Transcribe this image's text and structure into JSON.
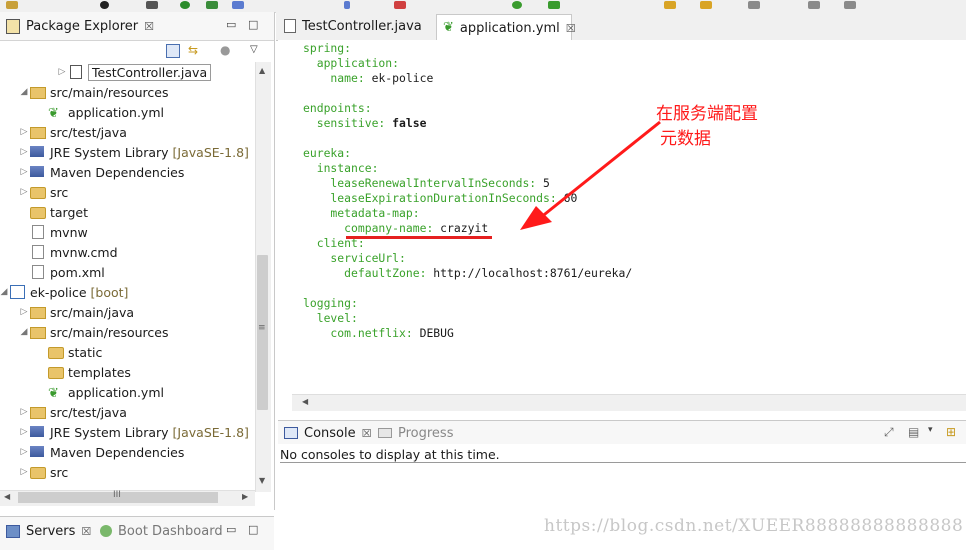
{
  "explorer": {
    "tab_label": "Package Explorer",
    "close": "☒",
    "rows": [
      {
        "label": "TestController.java",
        "deco": "",
        "type": "java"
      },
      {
        "label": "src/main/resources",
        "deco": "",
        "type": "pkgfolder"
      },
      {
        "label": "application.yml",
        "deco": "",
        "type": "yml"
      },
      {
        "label": "src/test/java",
        "deco": "",
        "type": "pkgfolder"
      },
      {
        "label": "JRE System Library",
        "deco": "[JavaSE-1.8]",
        "type": "lib"
      },
      {
        "label": "Maven Dependencies",
        "deco": "",
        "type": "lib"
      },
      {
        "label": "src",
        "deco": "",
        "type": "folder"
      },
      {
        "label": "target",
        "deco": "",
        "type": "folder"
      },
      {
        "label": "mvnw",
        "deco": "",
        "type": "file"
      },
      {
        "label": "mvnw.cmd",
        "deco": "",
        "type": "file"
      },
      {
        "label": "pom.xml",
        "deco": "",
        "type": "file"
      },
      {
        "label": "ek-police",
        "deco": "[boot]",
        "type": "project"
      },
      {
        "label": "src/main/java",
        "deco": "",
        "type": "pkgfolder"
      },
      {
        "label": "src/main/resources",
        "deco": "",
        "type": "pkgfolder"
      },
      {
        "label": "static",
        "deco": "",
        "type": "folder"
      },
      {
        "label": "templates",
        "deco": "",
        "type": "folder"
      },
      {
        "label": "application.yml",
        "deco": "",
        "type": "yml"
      },
      {
        "label": "src/test/java",
        "deco": "",
        "type": "pkgfolder"
      },
      {
        "label": "JRE System Library",
        "deco": "[JavaSE-1.8]",
        "type": "lib"
      },
      {
        "label": "Maven Dependencies",
        "deco": "",
        "type": "lib"
      },
      {
        "label": "src",
        "deco": "",
        "type": "folder"
      }
    ],
    "hscroll_grip": "III",
    "vscroll_grip": "≡"
  },
  "servers": {
    "tab_label": "Servers",
    "close": "☒",
    "boot_label": "Boot Dashboard"
  },
  "editor": {
    "tabs": [
      {
        "label": "TestController.java"
      },
      {
        "label": "application.yml",
        "close": "☒"
      }
    ],
    "lines": [
      {
        "k": "spring:",
        "v": ""
      },
      {
        "k": "  application:",
        "v": ""
      },
      {
        "k": "    name:",
        "v": " ek-police"
      },
      {
        "k": "",
        "v": ""
      },
      {
        "k": "endpoints:",
        "v": ""
      },
      {
        "k": "  sensitive:",
        "v": " false",
        "bold": true
      },
      {
        "k": "",
        "v": ""
      },
      {
        "k": "eureka:",
        "v": ""
      },
      {
        "k": "  instance:",
        "v": ""
      },
      {
        "k": "    leaseRenewalIntervalInSeconds:",
        "v": " 5"
      },
      {
        "k": "    leaseExpirationDurationInSeconds:",
        "v": " 60"
      },
      {
        "k": "    metadata-map:",
        "v": ""
      },
      {
        "k": "      company-name:",
        "v": " crazyit"
      },
      {
        "k": "  client:",
        "v": ""
      },
      {
        "k": "    serviceUrl:",
        "v": ""
      },
      {
        "k": "      defaultZone:",
        "v": " http://localhost:8761/eureka/"
      },
      {
        "k": "",
        "v": ""
      },
      {
        "k": "logging:",
        "v": ""
      },
      {
        "k": "  level:",
        "v": ""
      },
      {
        "k": "    com.netflix:",
        "v": " DEBUG"
      }
    ]
  },
  "console": {
    "tab_label": "Console",
    "close": "☒",
    "progress_label": "Progress",
    "message": "No consoles to display at this time."
  },
  "annotation": {
    "line1": "在服务端配置",
    "line2": "元数据"
  },
  "watermark": "https://blog.csdn.net/XUEER88888888888888",
  "colors": {
    "key": "#3aa22b",
    "annotation": "#ff1a1a"
  }
}
